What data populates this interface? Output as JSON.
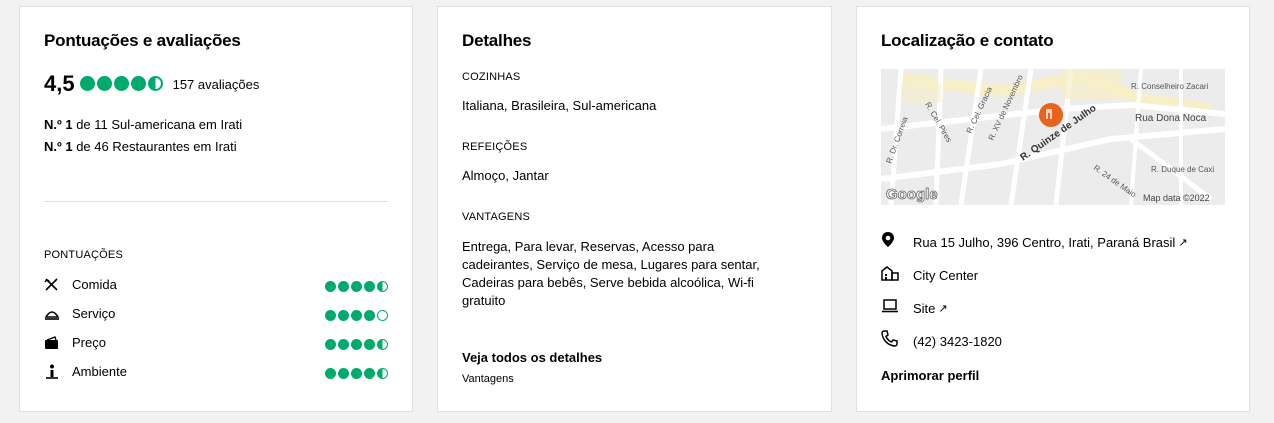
{
  "ratings": {
    "title": "Pontuações e avaliações",
    "score": "4,5",
    "reviews": "157 avaliações",
    "ranks": [
      {
        "bold": "N.º 1",
        "rest": " de 11 Sul-americana em Irati"
      },
      {
        "bold": "N.º 1",
        "rest": " de 46 Restaurantes em Irati"
      }
    ],
    "section_label": "PONTUAÇÕES",
    "items": [
      {
        "label": "Comida",
        "icon": "utensils-icon",
        "value": 4.5
      },
      {
        "label": "Serviço",
        "icon": "service-bell-icon",
        "value": 4.0
      },
      {
        "label": "Preço",
        "icon": "wallet-icon",
        "value": 4.5
      },
      {
        "label": "Ambiente",
        "icon": "ambience-icon",
        "value": 4.5
      }
    ],
    "overall_value": 4.5,
    "accent": "#00aa6c"
  },
  "details": {
    "title": "Detalhes",
    "sections": [
      {
        "label": "COZINHAS",
        "lines": [
          "Italiana, Brasileira, Sul-americana"
        ]
      },
      {
        "label": "REFEIÇÕES",
        "lines": [
          "Almoço, Jantar"
        ]
      },
      {
        "label": "VANTAGENS",
        "lines": [
          "Entrega, Para levar, Reservas, Acesso para",
          "cadeirantes, Serviço de mesa, Lugares para sentar,",
          "Cadeiras para bebês, Serve bebida alcoólica, Wi-fi",
          "gratuito"
        ]
      }
    ],
    "see_all": "Veja todos os detalhes",
    "see_all_sub": "Vantagens"
  },
  "location": {
    "title": "Localização e contato",
    "map": {
      "streets": [
        "R. Conselheiro Zacari",
        "Rua Dona Noca",
        "R. Dr. Correia",
        "R. Cel. Pires",
        "R. Cel. Gracia",
        "R. XV de Novembro",
        "R. Quinze de Julho",
        "R. 24 de Maio",
        "R. Duque de Caxi"
      ],
      "logo": "Google",
      "attribution": "Map data ©2022",
      "marker_color": "#e8641c"
    },
    "address": "Rua 15 Julho, 396 Centro, Irati, Paraná Brasil",
    "neighborhood": "City Center",
    "site": "Site",
    "phone": "(42) 3423-1820",
    "improve": "Aprimorar perfil"
  }
}
